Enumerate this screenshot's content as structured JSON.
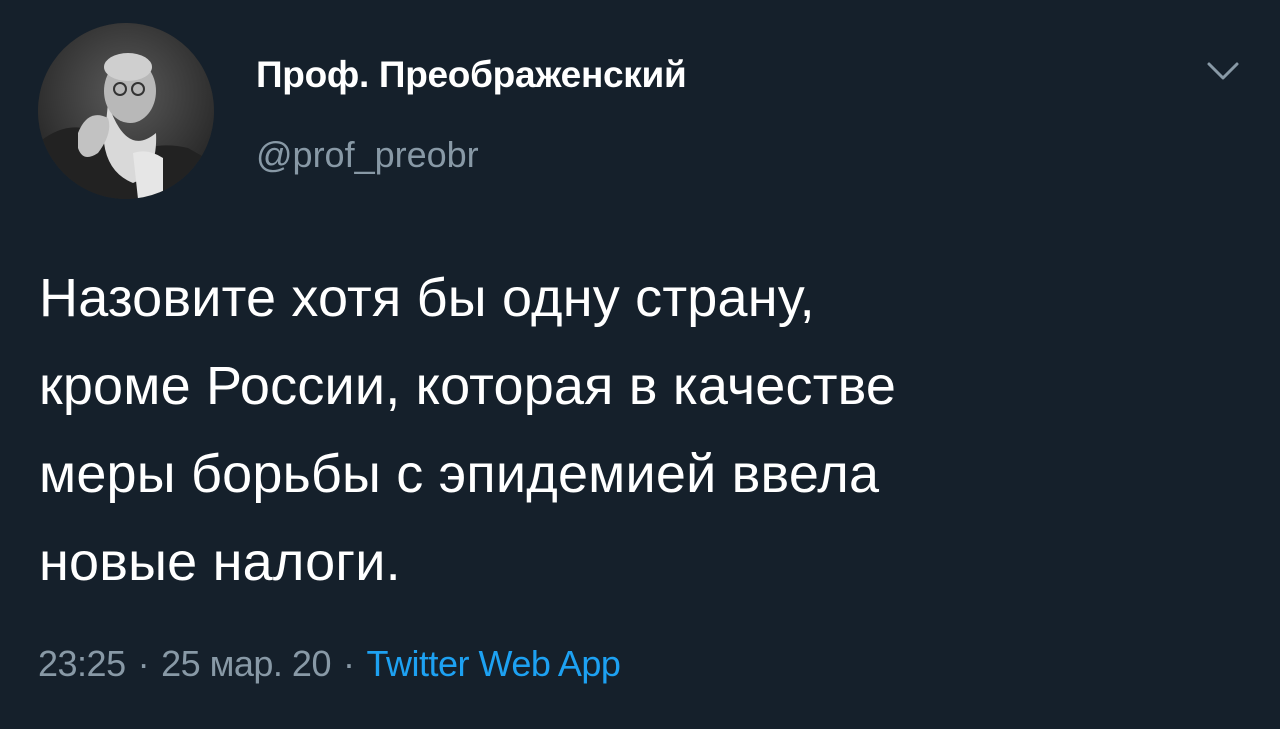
{
  "tweet": {
    "author": {
      "display_name": "Проф. Преображенский",
      "handle": "@prof_preobr",
      "avatar_icon": "profile-photo-avatar"
    },
    "text_lines": [
      "Назовите хотя бы одну страну,",
      "кроме России, которая в качестве",
      "меры борьбы с эпидемией ввела",
      "новые налоги."
    ],
    "meta": {
      "time": "23:25",
      "separator": "·",
      "date": "25 мар. 20",
      "source": "Twitter Web App"
    },
    "menu_icon": "chevron-down-icon"
  },
  "colors": {
    "background": "#15202b",
    "text": "#ffffff",
    "secondary_text": "#8899a6",
    "link": "#1da1f2"
  }
}
